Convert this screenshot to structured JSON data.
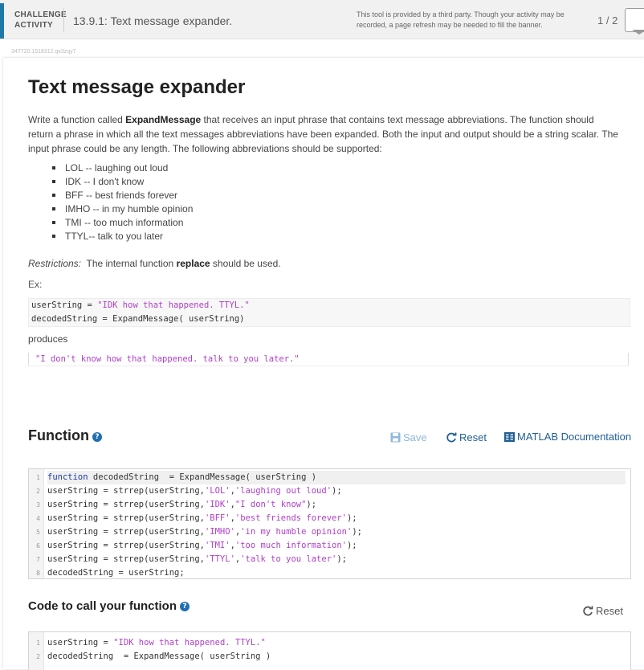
{
  "header": {
    "activity_label_line1": "CHALLENGE",
    "activity_label_line2": "ACTIVITY",
    "title": "13.9.1: Text message expander.",
    "third_party_notice": "This tool is provided by a third party. Though your activity may be recorded, a page refresh may be needed to fill the banner.",
    "pager": "1 / 2",
    "activity_id": "347720.1518312.qx3zqy7"
  },
  "problem": {
    "title": "Text message expander",
    "description_before": "Write a function called ",
    "function_name": "ExpandMessage",
    "description_after": " that receives an input phrase that contains text message abbreviations. The function should return a phrase in which all the text messages abbreviations have been expanded. Both the input and output should be a string scalar. The input phrase could be any length.  The following abbreviations should be supported:",
    "abbreviations": [
      "LOL -- laughing out loud",
      "IDK -- I don't know",
      "BFF -- best friends forever",
      "IMHO -- in my humble opinion",
      "TMI --  too much information",
      "TTYL--  talk to you later"
    ],
    "restrictions_label": "Restrictions:",
    "restrictions_before": "  The internal function ",
    "restrictions_func": "replace",
    "restrictions_after": " should be used.",
    "example_label": "Ex:",
    "example_line1_code": "userString = ",
    "example_line1_str": "\"IDK how that happened. TTYL.\"",
    "example_line2": "decodedString = ExpandMessage( userString)",
    "produces_label": "produces",
    "output": "\"I don't know how that happened. talk to you later.\""
  },
  "function_section": {
    "heading": "Function",
    "help_icon": "?",
    "save_label": "Save",
    "reset_label": "Reset",
    "doc_label": "MATLAB Documentation",
    "code_lines": [
      {
        "num": "1",
        "kw": "function",
        "rest": " decodedString  = ExpandMessage( userString )"
      },
      {
        "num": "2",
        "pre": "userString = strrep(userString,",
        "s1": "'LOL'",
        "mid": ",",
        "s2": "'laughing out loud'",
        "post": ");"
      },
      {
        "num": "3",
        "pre": "userString = strrep(userString,",
        "s1": "'IDK'",
        "mid": ",",
        "s2": "\"I don't know\"",
        "post": ");"
      },
      {
        "num": "4",
        "pre": "userString = strrep(userString,",
        "s1": "'BFF'",
        "mid": ",",
        "s2": "'best friends forever'",
        "post": ");"
      },
      {
        "num": "5",
        "pre": "userString = strrep(userString,",
        "s1": "'IMHO'",
        "mid": ",",
        "s2": "'in my humble opinion'",
        "post": ");"
      },
      {
        "num": "6",
        "pre": "userString = strrep(userString,",
        "s1": "'TMI'",
        "mid": ",",
        "s2": "'too much information'",
        "post": ");"
      },
      {
        "num": "7",
        "pre": "userString = strrep(userString,",
        "s1": "'TTYL'",
        "mid": ",",
        "s2": "'talk to you later'",
        "post": ");"
      },
      {
        "num": "8",
        "pre": "decodedString = userString;"
      }
    ]
  },
  "call_section": {
    "heading": "Code to call your function",
    "help_icon": "?",
    "reset_label": "Reset",
    "line1_num": "1",
    "line1_code": "userString = ",
    "line1_str": "\"IDK how that happened. TTYL.\"",
    "line2_num": "2",
    "line2_code": "decodedString  = ExpandMessage( userString )"
  },
  "colors": {
    "accent": "#1f79a8",
    "link": "#1f5f94",
    "string": "#b03fc9",
    "keyword": "#1d3aa5"
  }
}
